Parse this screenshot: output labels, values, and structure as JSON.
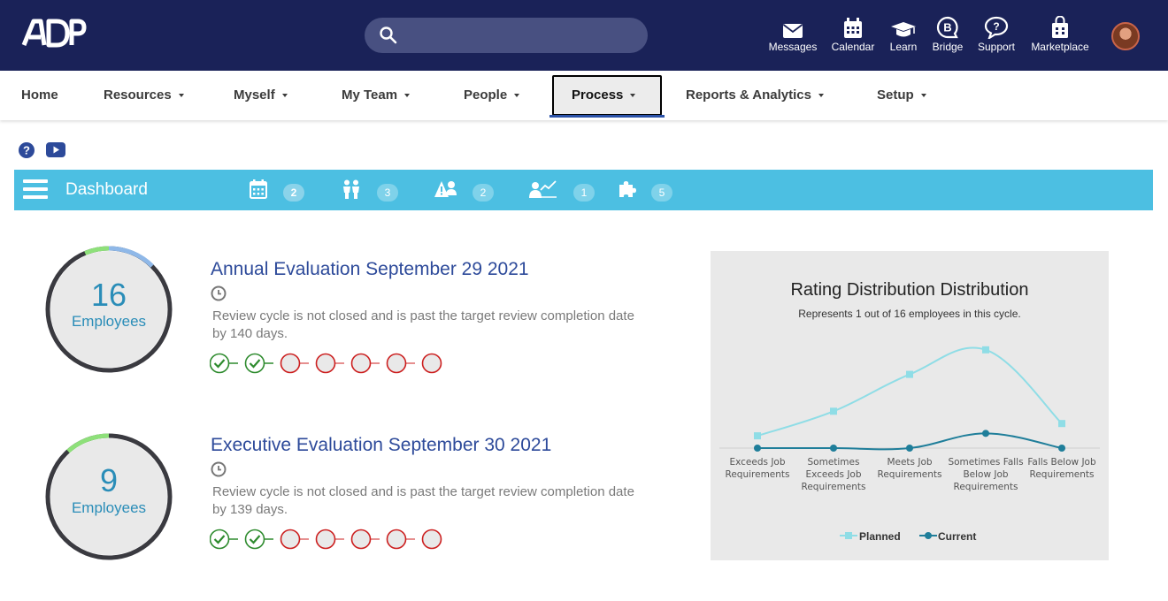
{
  "topbar": {
    "brand": "ADP",
    "search": {
      "placeholder": ""
    },
    "tools": [
      {
        "label": "Messages",
        "icon": "envelope-icon"
      },
      {
        "label": "Calendar",
        "icon": "calendar-icon"
      },
      {
        "label": "Learn",
        "icon": "graduation-cap-icon"
      },
      {
        "label": "Bridge",
        "icon": "bridge-icon"
      },
      {
        "label": "Support",
        "icon": "question-bubble-icon"
      },
      {
        "label": "Marketplace",
        "icon": "shopping-bag-icon"
      }
    ],
    "avatar": "user-avatar"
  },
  "nav": {
    "items": [
      {
        "label": "Home",
        "dropdown": false
      },
      {
        "label": "Resources",
        "dropdown": true
      },
      {
        "label": "Myself",
        "dropdown": true
      },
      {
        "label": "My Team",
        "dropdown": true
      },
      {
        "label": "People",
        "dropdown": true
      },
      {
        "label": "Process",
        "dropdown": true,
        "active": true
      },
      {
        "label": "Reports & Analytics",
        "dropdown": true
      },
      {
        "label": "Setup",
        "dropdown": true
      }
    ]
  },
  "help": {
    "help_icon": "question-circle-icon",
    "video_icon": "youtube-icon"
  },
  "dashboard": {
    "title": "Dashboard",
    "stats": [
      {
        "icon": "calendar-icon",
        "count": "2",
        "highlighted": true
      },
      {
        "icon": "people-icon",
        "count": "3"
      },
      {
        "icon": "warning-user-icon",
        "count": "2"
      },
      {
        "icon": "user-chart-icon",
        "count": "1"
      },
      {
        "icon": "puzzle-icon",
        "count": "5"
      }
    ]
  },
  "cycles": [
    {
      "count": "16",
      "count_label": "Employees",
      "title": "Annual Evaluation September 29 2021",
      "description": "Review cycle is not closed and is past the target review completion date by 140 days.",
      "steps": [
        "done",
        "done",
        "pending",
        "pending",
        "pending",
        "pending",
        "pending"
      ]
    },
    {
      "count": "9",
      "count_label": "Employees",
      "title": "Executive Evaluation September 30 2021",
      "description": "Review cycle is not closed and is past the target review completion date by 139 days.",
      "steps": [
        "done",
        "done",
        "pending",
        "pending",
        "pending",
        "pending",
        "pending"
      ]
    }
  ],
  "colors": {
    "header": "#1a2258",
    "accent_bar": "#4cbfe2",
    "title_blue": "#2d4a9a",
    "ring_dark": "#3a3a40",
    "ring_green": "#8ee07a",
    "ring_blue": "#8fb8e8",
    "step_done": "#2e8b2e",
    "step_pending": "#cc1f1f",
    "planned": "#8fdde6",
    "current": "#1f7e9a"
  },
  "chart_data": {
    "type": "line",
    "title": "Rating Distribution Distribution",
    "subtitle": "Represents 1 out of 16 employees in this cycle.",
    "categories": [
      "Exceeds Job Requirements",
      "Sometimes Exceeds Job Requirements",
      "Meets Job Requirements",
      "Sometimes Falls Below Job Requirements",
      "Falls Below Job Requirements"
    ],
    "series": [
      {
        "name": "Planned",
        "values": [
          5,
          15,
          30,
          40,
          10
        ]
      },
      {
        "name": "Current",
        "values": [
          0,
          0,
          0,
          6,
          0
        ]
      }
    ],
    "legend_position": "bottom",
    "grid": false
  }
}
